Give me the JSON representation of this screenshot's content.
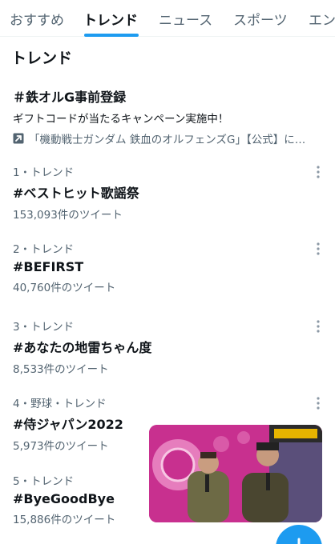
{
  "tabs": [
    {
      "label": "おすすめ",
      "active": false
    },
    {
      "label": "トレンド",
      "active": true
    },
    {
      "label": "ニュース",
      "active": false
    },
    {
      "label": "スポーツ",
      "active": false
    },
    {
      "label": "エン",
      "active": false
    }
  ],
  "section_title": "トレンド",
  "promoted": {
    "title": "＃鉄オルG事前登録",
    "description": "ギフトコードが当たるキャンペーン実施中！",
    "by": "「機動戦士ガンダム 鉄血のオルフェンズG」【公式】に…"
  },
  "trends": [
    {
      "meta": "1・トレンド",
      "name": "#ベストヒット歌謡祭",
      "count": "153,093件のツイート"
    },
    {
      "meta": "2・トレンド",
      "name": "#BEFIRST",
      "count": "40,760件のツイート"
    },
    {
      "meta": "3・トレンド",
      "name": "#あなたの地雷ちゃん度",
      "count": "8,533件のツイート"
    },
    {
      "meta": "4・野球・トレンド",
      "name": "#侍ジャパン2022",
      "count": "5,973件のツイート"
    },
    {
      "meta": "5・トレンド",
      "name": "#ByeGoodBye",
      "count": "15,886件のツイート"
    }
  ],
  "colors": {
    "accent": "#1d9bf0",
    "secondary_text": "#536471",
    "primary_text": "#0f1419"
  },
  "icons": {
    "promoted": "promoted-arrow-icon",
    "more": "more-vertical-icon",
    "fab": "compose-tweet-icon"
  }
}
